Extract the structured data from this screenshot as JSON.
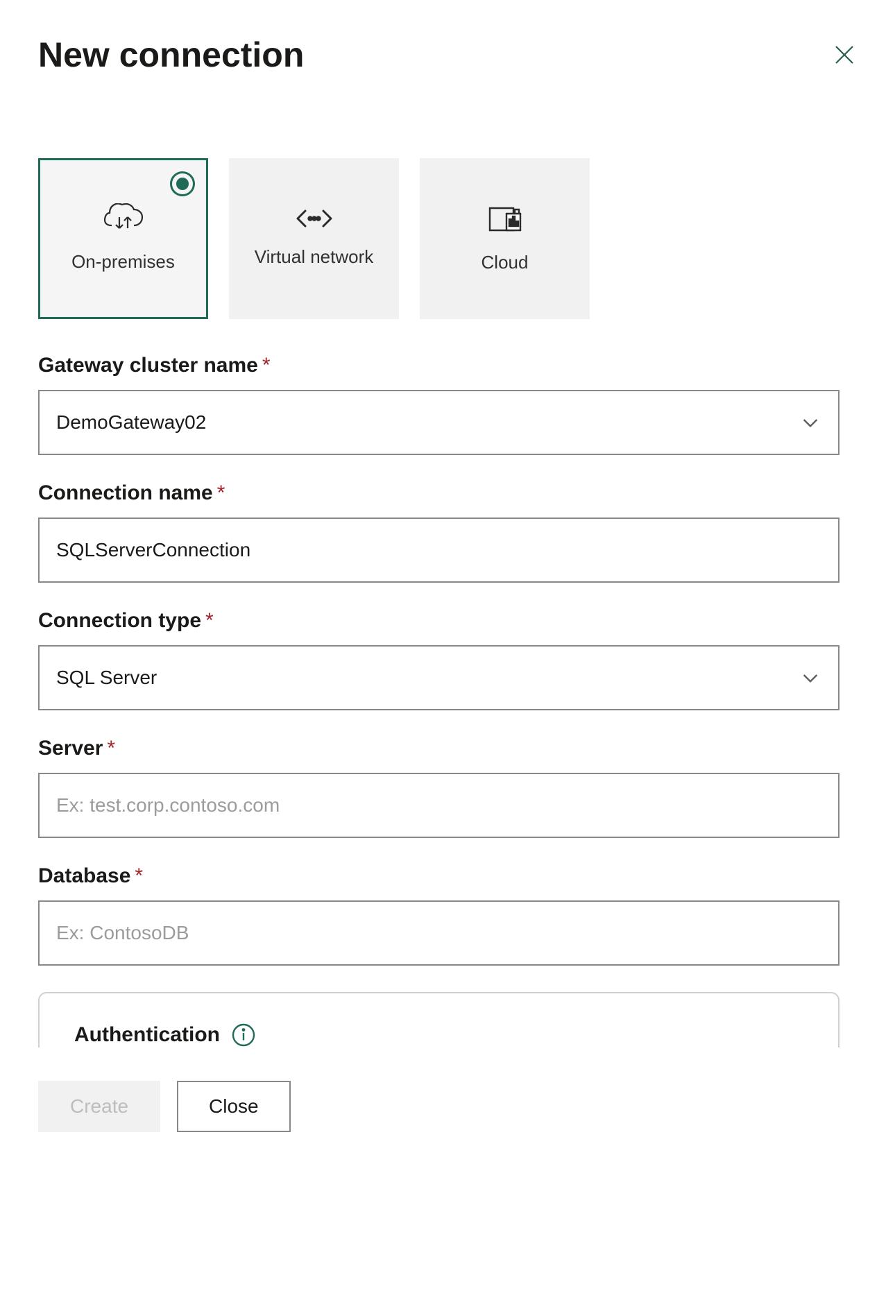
{
  "header": {
    "title": "New connection"
  },
  "tiles": {
    "on_premises": "On-premises",
    "virtual_network": "Virtual network",
    "cloud": "Cloud"
  },
  "fields": {
    "gateway": {
      "label": "Gateway cluster name",
      "value": "DemoGateway02"
    },
    "conn_name": {
      "label": "Connection name",
      "value": "SQLServerConnection"
    },
    "conn_type": {
      "label": "Connection type",
      "value": "SQL Server"
    },
    "server": {
      "label": "Server",
      "placeholder": "Ex: test.corp.contoso.com"
    },
    "database": {
      "label": "Database",
      "placeholder": "Ex: ContosoDB"
    }
  },
  "auth": {
    "title": "Authentication"
  },
  "footer": {
    "create": "Create",
    "close": "Close"
  },
  "required_mark": "*"
}
